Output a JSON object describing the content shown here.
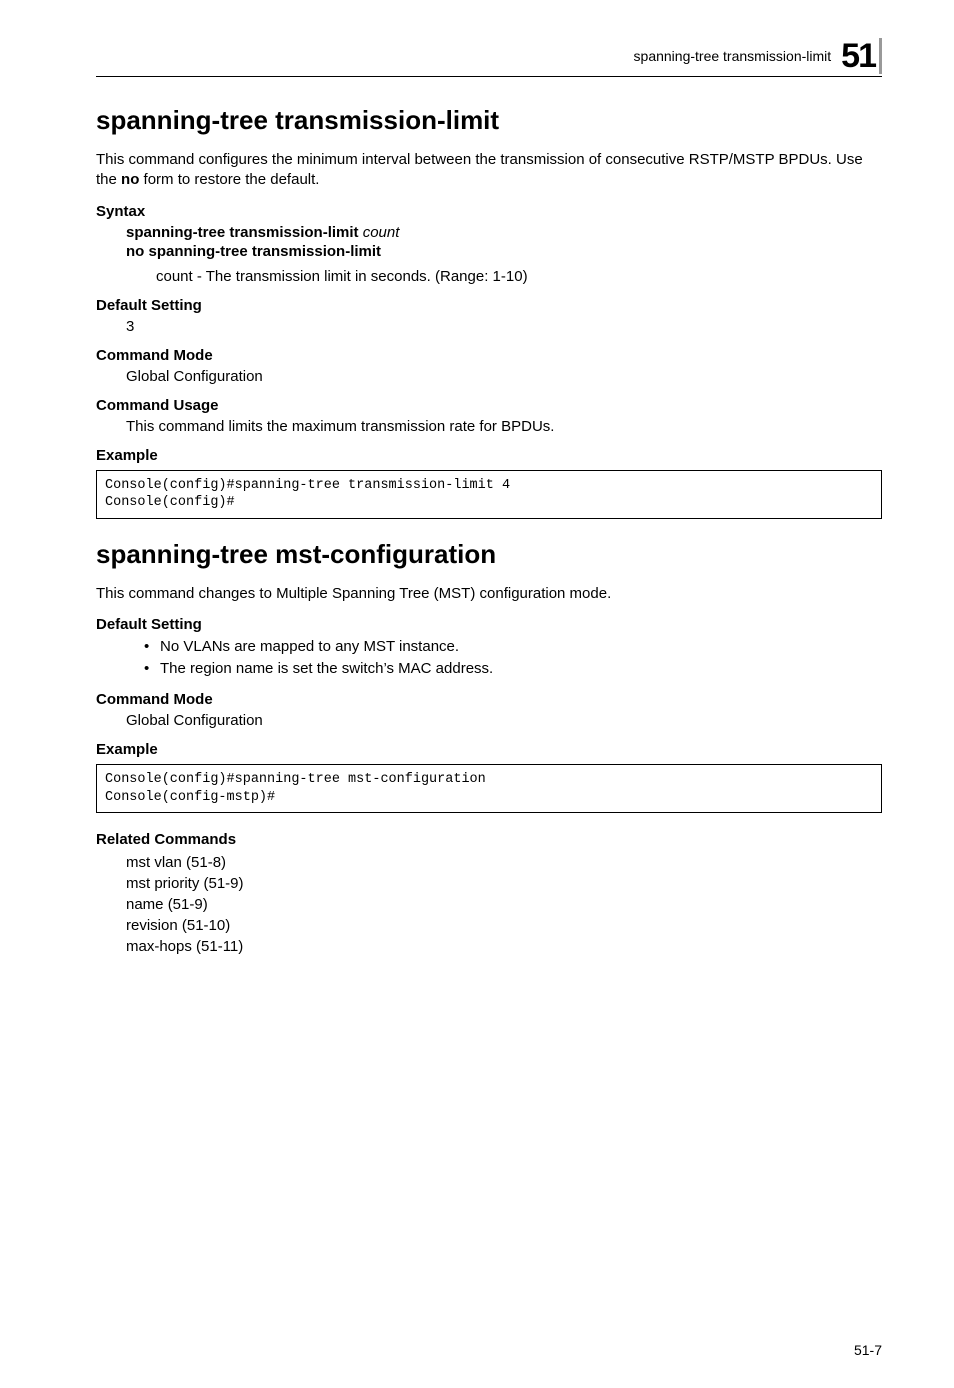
{
  "header": {
    "running_title": "spanning-tree transmission-limit",
    "chapter_number": "51"
  },
  "section1": {
    "title": "spanning-tree transmission-limit",
    "intro_a": "This command configures the minimum interval between the transmission of consecutive RSTP/MSTP BPDUs. Use the ",
    "intro_no": "no",
    "intro_b": " form to restore the default.",
    "syntax_label": "Syntax",
    "syntax_line1_bold": "spanning-tree transmission-limit ",
    "syntax_line1_italic": "count",
    "syntax_line2_bold": "no spanning-tree transmission-limit",
    "param_italic": "count",
    "param_rest": " - The transmission limit in seconds. (Range: 1-10)",
    "default_label": "Default Setting",
    "default_value": "3",
    "mode_label": "Command Mode",
    "mode_value": "Global Configuration",
    "usage_label": "Command Usage",
    "usage_value": "This command limits the maximum transmission rate for BPDUs.",
    "example_label": "Example",
    "example_code": "Console(config)#spanning-tree transmission-limit 4\nConsole(config)#"
  },
  "section2": {
    "title": "spanning-tree mst-configuration",
    "intro": "This command changes to Multiple Spanning Tree (MST) configuration mode.",
    "default_label": "Default Setting",
    "bullet1": "No VLANs are mapped to any MST instance.",
    "bullet2": "The region name is set the switch’s MAC address.",
    "mode_label": "Command Mode",
    "mode_value": "Global Configuration",
    "example_label": "Example",
    "example_code": "Console(config)#spanning-tree mst-configuration\nConsole(config-mstp)#",
    "related_label": "Related Commands",
    "related1": "mst vlan (51-8)",
    "related2": "mst priority (51-9)",
    "related3": "name (51-9)",
    "related4": "revision (51-10)",
    "related5": "max-hops (51-11)"
  },
  "footer": {
    "page_number": "51-7"
  }
}
